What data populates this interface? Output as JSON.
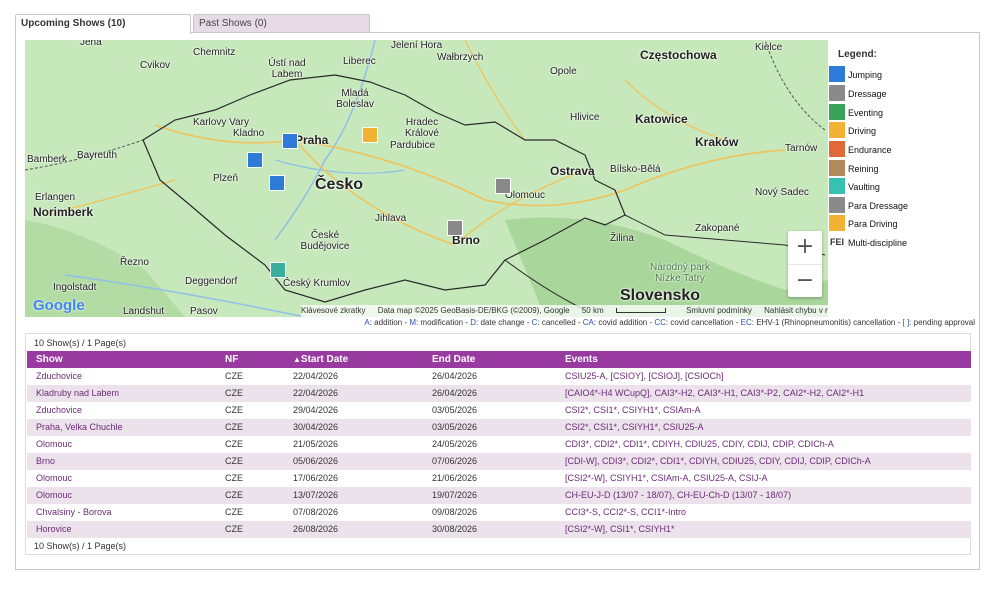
{
  "tabs": [
    {
      "label": "Upcoming Shows (10)",
      "active": true
    },
    {
      "label": "Past Shows (0)",
      "active": false
    }
  ],
  "map": {
    "country_label": "Česko",
    "neighbor_label": "Slovensko",
    "cities": [
      "Jena",
      "Chemnitz",
      "Jelení Hora",
      "Wałbrzych",
      "Częstochowa",
      "Kielce",
      "Cvikov",
      "Ústí nad Labem",
      "Liberec",
      "Opole",
      "Mladá Boleslav",
      "Karlovy Vary",
      "Kladno",
      "Praha",
      "Hradec Králové",
      "Pardubice",
      "Hlivice",
      "Katowice",
      "Kraków",
      "Tarnów",
      "Bamberk",
      "Bayreuth",
      "Plzeň",
      "Ostrava",
      "Bílsko-Bělá",
      "Nový Sadec",
      "Erlangen",
      "Norimberk",
      "Jihlava",
      "Olomouc",
      "Brno",
      "Zakopané",
      "Žilina",
      "Řezno",
      "České Budějovice",
      "Deggendorf",
      "Český Krumlov",
      "Ingolstadt",
      "Landshut",
      "Pasov"
    ],
    "region_label": "Národný park Nízke Tatry",
    "attribution": {
      "shortcuts": "Klávesové zkratky",
      "data": "Data map ©2025 GeoBasis-DE/BKG (©2009), Google",
      "scale": "50 km",
      "terms": "Smluvní podmínky",
      "report": "Nahlásit chybu v mapě"
    },
    "google_logo": "Google",
    "zoom_in": "+",
    "zoom_out": "−"
  },
  "legend": {
    "title": "Legend:",
    "items": [
      {
        "label": "Jumping",
        "color": "#2f7cd8"
      },
      {
        "label": "Dressage",
        "color": "#8a8a8a"
      },
      {
        "label": "Eventing",
        "color": "#3aa35a"
      },
      {
        "label": "Driving",
        "color": "#f2b233"
      },
      {
        "label": "Endurance",
        "color": "#e0693a"
      },
      {
        "label": "Reining",
        "color": "#b08a5a"
      },
      {
        "label": "Vaulting",
        "color": "#38c0b0"
      },
      {
        "label": "Para Dressage",
        "color": "#8a8a8a"
      },
      {
        "label": "Para Driving",
        "color": "#f2b233"
      },
      {
        "label": "Multi-discipline",
        "color": "#ffffff",
        "badge": "FEI"
      }
    ]
  },
  "codes_line": [
    {
      "code": "A",
      "text": ": addition"
    },
    {
      "code": "M",
      "text": ": modification"
    },
    {
      "code": "D",
      "text": ": date change"
    },
    {
      "code": "C",
      "text": ": cancelled"
    },
    {
      "code": "CA",
      "text": ": covid addition"
    },
    {
      "code": "CC",
      "text": ": covid cancellation"
    },
    {
      "code": "EC",
      "text": ": EHV-1 (Rhinopneumonitis) cancellation"
    },
    {
      "code": "[ ]",
      "text": ": pending approval"
    }
  ],
  "table": {
    "page_info_top": "10 Show(s) / 1 Page(s)",
    "page_info_bottom": "10 Show(s) / 1 Page(s)",
    "headers": {
      "show": "Show",
      "nf": "NF",
      "start": "Start Date",
      "end": "End Date",
      "events": "Events",
      "sort_indicator": "▲"
    },
    "rows": [
      {
        "show": "Zduchovice",
        "nf": "CZE",
        "start": "22/04/2026",
        "end": "26/04/2026",
        "events": "CSIU25-A, [CSIOY], [CSIOJ], [CSIOCh]"
      },
      {
        "show": "Kladruby nad Labem",
        "nf": "CZE",
        "start": "22/04/2026",
        "end": "26/04/2026",
        "events": "[CAIO4*-H4 WCupQ], CAI3*-H2, CAI3*-H1, CAI3*-P2, CAI2*-H2, CAI2*-H1"
      },
      {
        "show": "Zduchovice",
        "nf": "CZE",
        "start": "29/04/2026",
        "end": "03/05/2026",
        "events": "CSI2*, CSI1*, CSIYH1*, CSIAm-A"
      },
      {
        "show": "Praha, Velka Chuchle",
        "nf": "CZE",
        "start": "30/04/2026",
        "end": "03/05/2026",
        "events": "CSI2*, CSI1*, CSIYH1*, CSIU25-A"
      },
      {
        "show": "Olomouc",
        "nf": "CZE",
        "start": "21/05/2026",
        "end": "24/05/2026",
        "events": "CDI3*, CDI2*, CDI1*, CDIYH, CDIU25, CDIY, CDIJ, CDIP, CDICh-A"
      },
      {
        "show": "Brno",
        "nf": "CZE",
        "start": "05/06/2026",
        "end": "07/06/2026",
        "events": "[CDI-W], CDI3*, CDI2*, CDI1*, CDIYH, CDIU25, CDIY, CDIJ, CDIP, CDICh-A"
      },
      {
        "show": "Olomouc",
        "nf": "CZE",
        "start": "17/06/2026",
        "end": "21/06/2026",
        "events": "[CSI2*-W], CSIYH1*, CSIAm-A, CSIU25-A, CSIJ-A"
      },
      {
        "show": "Olomouc",
        "nf": "CZE",
        "start": "13/07/2026",
        "end": "19/07/2026",
        "events": "CH-EU-J-D (13/07 - 18/07), CH-EU-Ch-D (13/07 - 18/07)"
      },
      {
        "show": "Chvalsiny - Borova",
        "nf": "CZE",
        "start": "07/08/2026",
        "end": "09/08/2026",
        "events": "CCI3*-S, CCI2*-S, CCI1*-Intro"
      },
      {
        "show": "Horovice",
        "nf": "CZE",
        "start": "26/08/2026",
        "end": "30/08/2026",
        "events": "[CSI2*-W], CSI1*, CSIYH1*"
      }
    ]
  }
}
